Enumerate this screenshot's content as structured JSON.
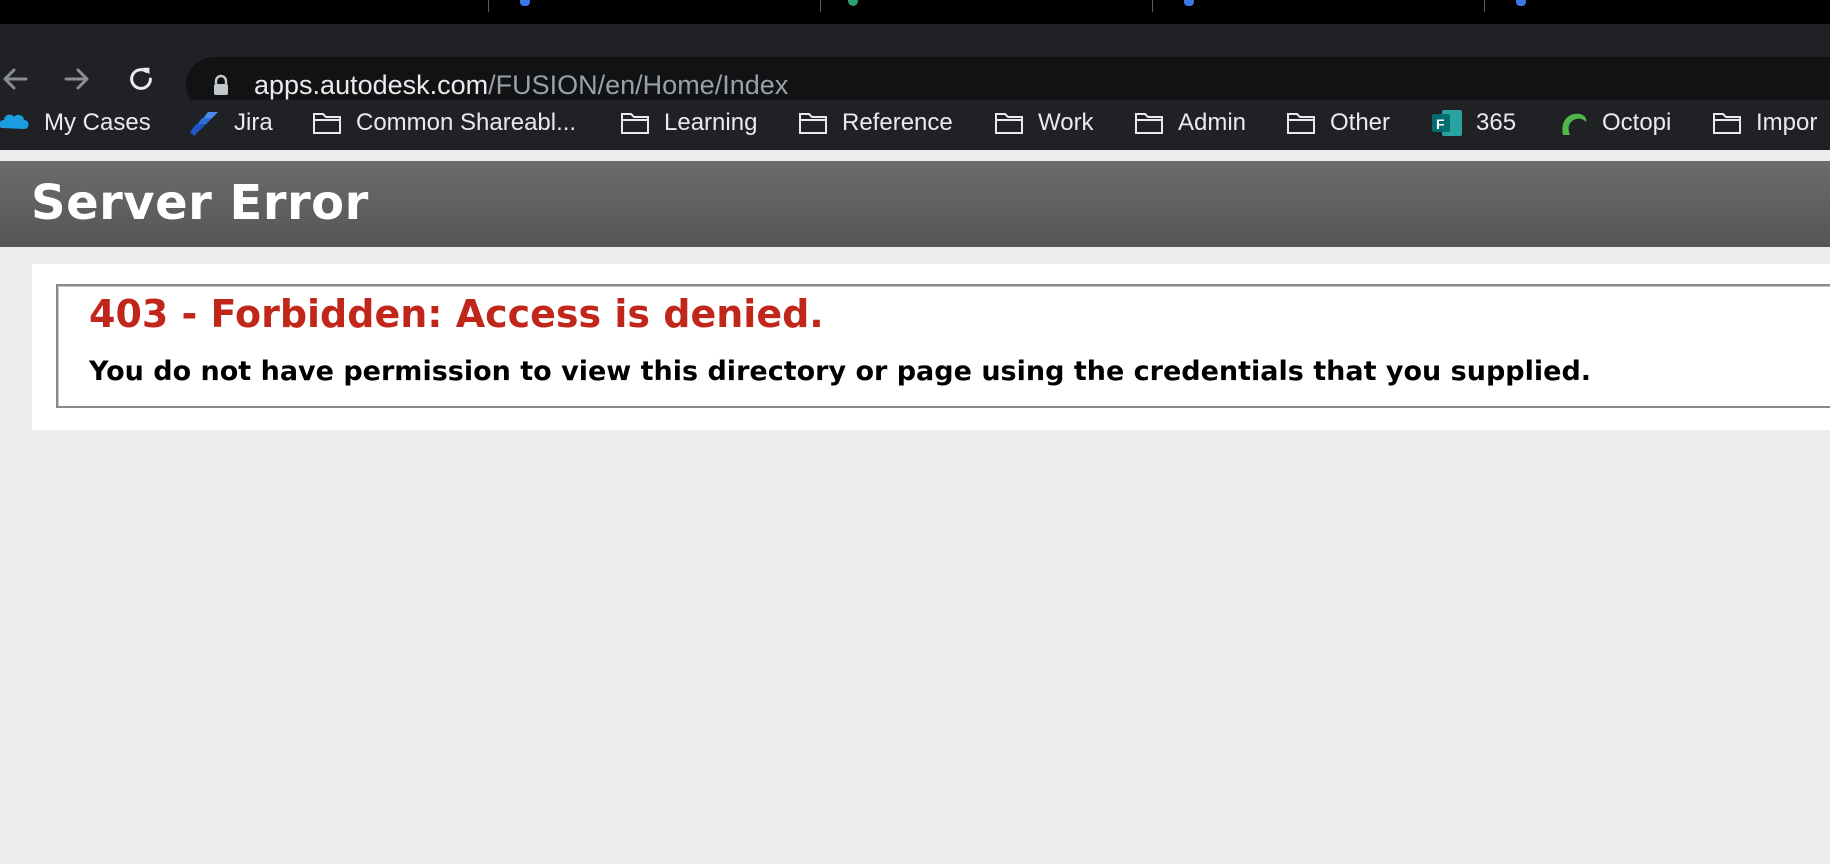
{
  "browser": {
    "address_bar": {
      "host": "apps.autodesk.com",
      "path": "/FUSION/en/Home/Index"
    },
    "bookmarks": [
      {
        "label": "My Cases",
        "icon": "salesforce-cloud-icon"
      },
      {
        "label": "Jira",
        "icon": "jira-icon"
      },
      {
        "label": "Common Shareabl...",
        "icon": "folder-icon"
      },
      {
        "label": "Learning",
        "icon": "folder-icon"
      },
      {
        "label": "Reference",
        "icon": "folder-icon"
      },
      {
        "label": "Work",
        "icon": "folder-icon"
      },
      {
        "label": "Admin",
        "icon": "folder-icon"
      },
      {
        "label": "Other",
        "icon": "folder-icon"
      },
      {
        "label": "365",
        "icon": "microsoft-forms-icon"
      },
      {
        "label": "Octopi",
        "icon": "octopi-icon"
      },
      {
        "label": "Impor",
        "icon": "folder-icon"
      }
    ]
  },
  "page": {
    "header_title": "Server Error",
    "error_title": "403 - Forbidden: Access is denied.",
    "error_message": "You do not have permission to view this directory or page using the credentials that you supplied."
  },
  "colors": {
    "error_red": "#c0261a",
    "header_gray": "#5f5f5f",
    "page_bg": "#ececec",
    "toolbar_bg": "#202124"
  }
}
